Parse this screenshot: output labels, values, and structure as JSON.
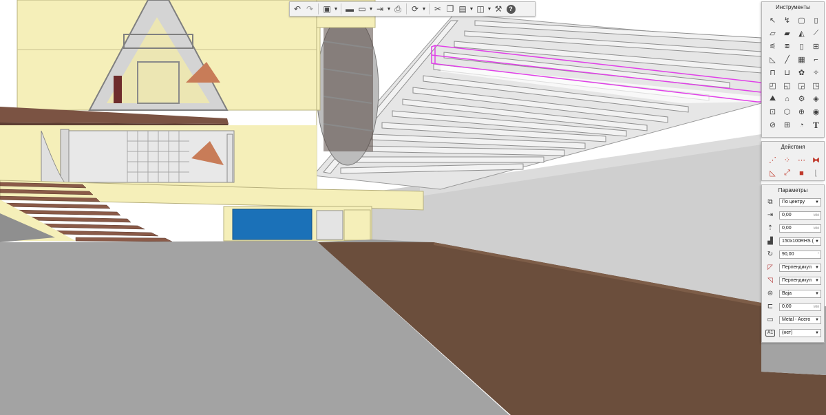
{
  "toolbar": {
    "items": [
      {
        "icon": "undo-icon"
      },
      {
        "icon": "redo-icon"
      },
      {
        "icon": "3d-view-icon"
      },
      {
        "icon": "open-folder-icon"
      },
      {
        "icon": "save-icon"
      },
      {
        "icon": "export-icon"
      },
      {
        "icon": "print-icon"
      },
      {
        "icon": "sync-icon"
      },
      {
        "icon": "cut-icon"
      },
      {
        "icon": "copy-icon"
      },
      {
        "icon": "paste-icon"
      },
      {
        "icon": "visual-style-icon"
      },
      {
        "icon": "settings-wrench-icon"
      },
      {
        "icon": "help-icon"
      }
    ]
  },
  "tools_panel": {
    "title": "Инструменты",
    "tools": [
      "select-arrow-icon",
      "lasso-select-icon",
      "rectangle-select-icon",
      "column-icon",
      "wall-icon",
      "slab-icon",
      "roof-icon",
      "beam-icon",
      "stair-icon",
      "railing-icon",
      "door-icon",
      "window-icon",
      "ramp-icon",
      "line-icon",
      "curtain-wall-icon",
      "profile-icon",
      "furniture-icon",
      "sanitary-icon",
      "plant-icon",
      "light-icon",
      "hole-icon",
      "opening-icon",
      "wall-opening-icon",
      "round-opening-icon",
      "terrain-icon",
      "building-icon",
      "mep-icon",
      "space-icon",
      "section-icon",
      "elevation-icon",
      "detail-icon",
      "annotation-icon",
      "zone-icon",
      "grid-icon",
      "label-icon",
      "text-icon"
    ]
  },
  "actions_panel": {
    "title": "Действия",
    "actions": [
      "move-icon",
      "copy-move-icon",
      "array-icon",
      "mirror-icon",
      "rotate-icon",
      "scale-icon",
      "delete-icon",
      "align-icon"
    ]
  },
  "params_panel": {
    "title": "Параметры",
    "rows": [
      {
        "icon": "alignment-icon",
        "value": "По центру",
        "kind": "dropdown"
      },
      {
        "icon": "offset-x-icon",
        "value": "0,00",
        "unit": "мм",
        "kind": "number"
      },
      {
        "icon": "offset-y-icon",
        "value": "0,00",
        "unit": "мм",
        "kind": "number"
      },
      {
        "icon": "profile-section-icon",
        "value": "150x100RHS (",
        "kind": "dropdown"
      },
      {
        "icon": "rotation-icon",
        "value": "90,00",
        "unit": "°",
        "kind": "number"
      },
      {
        "icon": "start-cut-icon",
        "value": "Перпендикул",
        "kind": "dropdown"
      },
      {
        "icon": "end-cut-icon",
        "value": "Перпендикул",
        "kind": "dropdown"
      },
      {
        "icon": "level-icon",
        "value": "Baja",
        "kind": "dropdown"
      },
      {
        "icon": "elevation-offset-icon",
        "value": "0,00",
        "unit": "мм",
        "kind": "number"
      },
      {
        "icon": "material-icon",
        "value": "Metal - Acero",
        "kind": "dropdown"
      },
      {
        "icon": "tag-a1-icon",
        "value": "(нет)",
        "kind": "dropdown"
      }
    ]
  },
  "colors": {
    "selection": "#e040e8",
    "wall_cream": "#f5efb9",
    "floor_grey": "#a3a3a3",
    "floor_brown": "#6b4e3c",
    "door_blue": "#1b71b8",
    "stair_brown": "#8a5a48"
  }
}
